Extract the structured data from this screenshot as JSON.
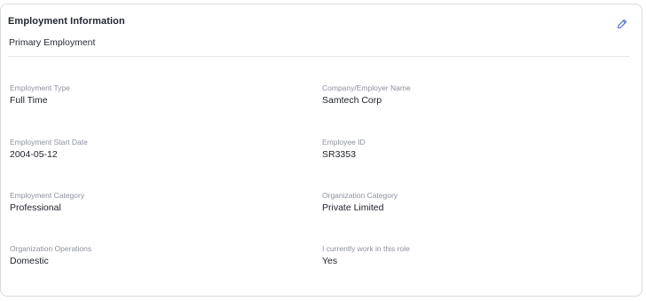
{
  "card": {
    "title": "Employment Information",
    "subtitle": "Primary Employment",
    "edit_icon": "pencil-icon",
    "accent_color": "#4a6fd6"
  },
  "fields": [
    {
      "label": "Employment Type",
      "value": "Full Time"
    },
    {
      "label": "Company/Employer Name",
      "value": "Samtech Corp"
    },
    {
      "label": "Employment Start Date",
      "value": "2004-05-12"
    },
    {
      "label": "Employee ID",
      "value": "SR3353"
    },
    {
      "label": "Employment Category",
      "value": "Professional"
    },
    {
      "label": "Organization Category",
      "value": "Private Limited"
    },
    {
      "label": "Organization Operations",
      "value": "Domestic"
    },
    {
      "label": "I currently work in this role",
      "value": "Yes"
    }
  ]
}
